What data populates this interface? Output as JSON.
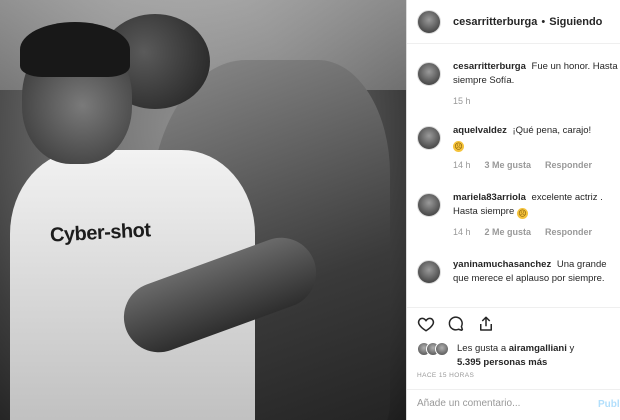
{
  "photo": {
    "shirt_text": "Cyber-shot"
  },
  "header": {
    "username": "cesarritterburga",
    "separator": "•",
    "follow_status": "Siguiendo"
  },
  "comments": [
    {
      "user": "cesarritterburga",
      "text": "Fue un honor. Hasta siempre Sofía.",
      "time": "15 h"
    },
    {
      "user": "aquelvaldez",
      "text": "¡Qué pena, carajo!",
      "emoji": "☹",
      "time": "14 h",
      "likes": "3 Me gusta",
      "reply": "Responder"
    },
    {
      "user": "mariela83arriola",
      "text": "excelente actriz . Hasta siempre",
      "emoji": "☹",
      "time": "14 h",
      "likes": "2 Me gusta",
      "reply": "Responder"
    },
    {
      "user": "yaninamuchasanchez",
      "text": "Una grande que merece el aplauso por siempre."
    }
  ],
  "actions": {
    "like_icon": "heart-icon",
    "comment_icon": "comment-icon",
    "share_icon": "share-icon"
  },
  "likes": {
    "prefix": "Les gusta a",
    "user": "airamgalliani",
    "conj": "y",
    "count": "5.395 personas más"
  },
  "timestamp": "HACE 15 HORAS",
  "add_comment": {
    "placeholder": "Añade un comentario...",
    "publish_label": "Publicar"
  },
  "colors": {
    "publish_disabled": "#b2dffc",
    "meta_gray": "#999999",
    "emoji_yellow": "#f5c33b"
  }
}
